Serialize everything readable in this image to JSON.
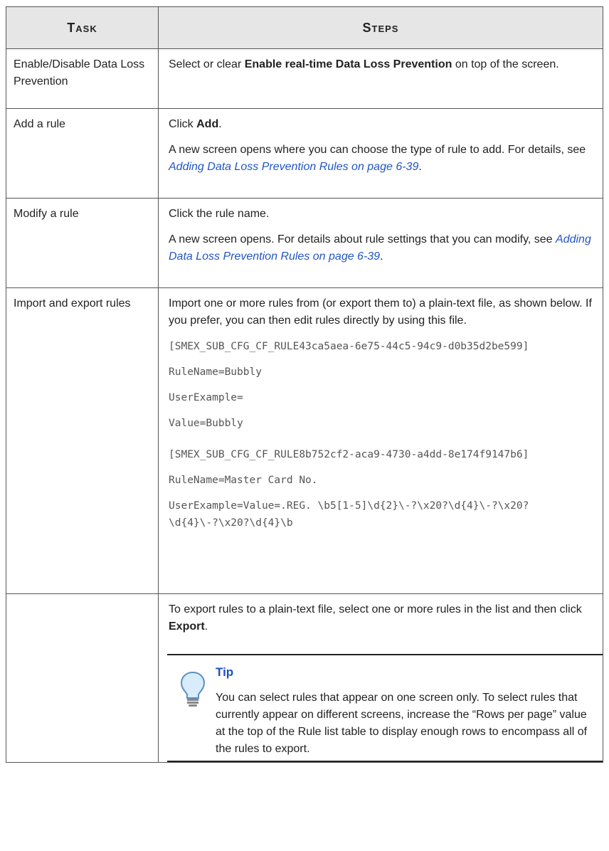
{
  "table": {
    "headers": {
      "task": "Task",
      "steps": "Steps"
    },
    "rows": [
      {
        "task": "Enable/Disable Data Loss Prevention",
        "step_pre": "Select or clear ",
        "step_bold": "Enable real-time Data Loss Prevention",
        "step_post": " on top of the screen."
      },
      {
        "task": "Add a rule",
        "p1_pre": "Click ",
        "p1_bold": "Add",
        "p1_post": ".",
        "p2_pre": "A new screen opens where you can choose the type of rule to add. For details, see ",
        "p2_link": "Adding Data Loss Prevention Rules on page 6-39",
        "p2_post": "."
      },
      {
        "task": "Modify a rule",
        "p1": "Click the rule name.",
        "p2_pre": "A new screen opens. For details about rule settings that you can modify, see ",
        "p2_link": "Adding Data Loss Prevention Rules on page 6-39",
        "p2_post": "."
      },
      {
        "task": "Import and export rules",
        "intro": "Import one or more rules from (or export them to) a plain-text file, as shown below. If you prefer, you can then edit rules directly by using this file.",
        "code": [
          "[SMEX_SUB_CFG_CF_RULE43ca5aea-6e75-44c5-94c9-d0b35d2be599]",
          "RuleName=Bubbly",
          "UserExample=",
          "Value=Bubbly",
          "[SMEX_SUB_CFG_CF_RULE8b752cf2-aca9-4730-a4dd-8e174f9147b6]",
          "RuleName=Master Card No.",
          "UserExample=Value=.REG. \\b5[1-5]\\d{2}\\-?\\x20?\\d{4}\\-?\\x20?\\d{4}\\-?\\x20?\\d{4}\\b"
        ]
      },
      {
        "task": "",
        "export_pre": "To export rules to a plain-text file, select one or more rules in the list and then click ",
        "export_bold": "Export",
        "export_post": ".",
        "tip_title": "Tip",
        "tip_text": "You can select rules that appear on one screen only. To select rules that currently appear on different screens, increase the “Rows per page” value at the top of the Rule list table to display enough rows to encompass all of the rules to export.",
        "tip_icon": "lightbulb-icon"
      }
    ]
  },
  "colors": {
    "link": "#2255c4",
    "tip_title": "#1d4fc4",
    "header_bg": "#e6e6e6"
  }
}
